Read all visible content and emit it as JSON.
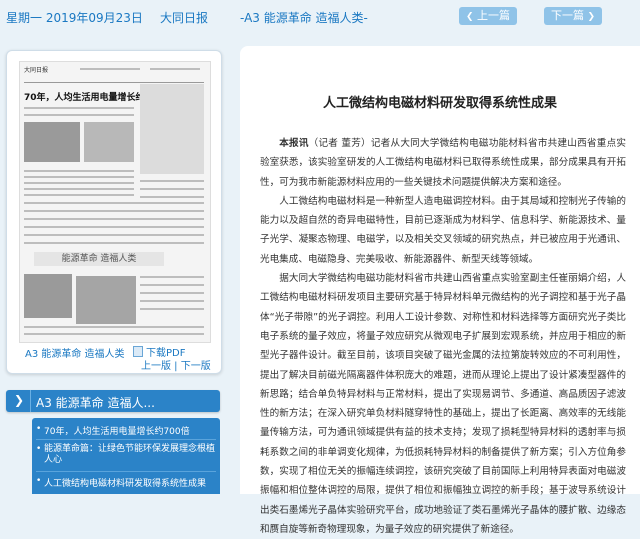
{
  "topbar": {
    "date": "星期一 2019年09月23日",
    "paper": "大同日报",
    "page": "-A3 能源革命 造福人类-",
    "prev_label": "上一篇",
    "next_label": "下一篇"
  },
  "left_card": {
    "page_label": "A3 能源革命 造福人类",
    "pdf_label": "下载PDF",
    "prev_page": "上一版",
    "next_page": "下一版",
    "thumb_headline": "70年，人均生活用电量增长约700倍",
    "thumb_band": "能源革命 造福人类",
    "thumb_mast": "大同日报"
  },
  "section": {
    "title": "A3 能源革命 造福人...",
    "items": [
      "70年，人均生活用电量增长约700倍",
      "能源革命篇：让绿色节能环保发展理念根植人心",
      "人工微结构电磁材料研发取得系统性成果"
    ]
  },
  "article": {
    "title": "人工微结构电磁材料研发取得系统性成果",
    "lead_label": "本报讯",
    "lead_rest": "（记者 董芳）记者从大同大学微结构电磁功能材料省市共建山西省重点实验室获悉，该实验室研发的人工微结构电磁材料已取得系统性成果，部分成果具有开拓性，可为我市新能源材料应用的一些关键技术问题提供解决方案和途径。",
    "p2": "人工微结构电磁材料是一种新型人造电磁调控材料。由于其局域和控制光子传输的能力以及超自然的奇异电磁特性，目前已逐渐成为材料学、信息科学、新能源技术、量子光学、凝聚态物理、电磁学，以及相关交叉领域的研究热点，并已被应用于光通讯、光电集成、电磁隐身、完美吸收、新能源器件、新型天线等领域。",
    "p3": "据大同大学微结构电磁功能材料省市共建山西省重点实验室副主任崔丽娟介绍，人工微结构电磁材料研发项目主要研究基于特异材料单元微结构的光子调控和基于光子晶体“光子带隙”的光子调控。利用人工设计参数、对称性和材料选择等方面研究光子类比电子系统的量子效应，将量子效应研究从微观电子扩展到宏观系统，并应用于相应的新型光子器件设计。截至目前，该项目突破了磁光金属的法拉第旋转效应的不可利用性，提出了解决目前磁光隔离器件体积庞大的难题，进而从理论上提出了设计紧凑型器件的新思路；结合单负特异材料与正常材料，提出了实现易调节、多通道、高品质因子滤波性的新方法；在深入研究单负材料隧穿特性的基础上，提出了长距离、高效率的无线能量传输方法，可为通讯领域提供有益的技术支持；发现了损耗型特异材料的透射率与损耗系数之间的非单调变化规律，为低损耗特异材料的制备提供了新方案；引入方位角参数，实现了相位无关的振幅连续调控，该研究突破了目前国际上利用特异表面对电磁波振幅和相位整体调控的局限，提供了相位和振幅独立调控的新手段；基于波导系统设计出类石墨烯光子晶体实验研究平台，成功地验证了类石墨烯光子晶体的腰扩散、边缘态和赝自旋等新奇物理现象，为量子效应的研究提供了新途径。"
  }
}
